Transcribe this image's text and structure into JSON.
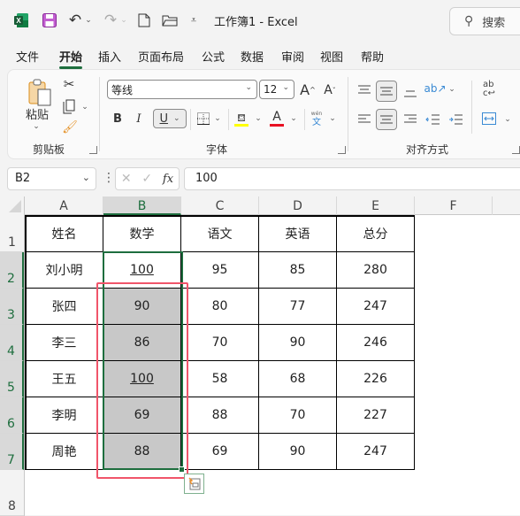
{
  "app": {
    "doc_title": "工作簿1 - Excel",
    "search_placeholder": "搜索",
    "icons": {
      "app_logo": "excel-logo-icon",
      "save": "save-icon",
      "undo": "undo-icon",
      "redo": "redo-icon",
      "new": "new-file-icon",
      "open": "open-folder-icon",
      "customize": "customize-toolbar-icon",
      "search": "search-icon"
    }
  },
  "menu_tabs": [
    {
      "label": "文件",
      "active": false
    },
    {
      "label": "开始",
      "active": true
    },
    {
      "label": "插入",
      "active": false
    },
    {
      "label": "页面布局",
      "active": false
    },
    {
      "label": "公式",
      "active": false
    },
    {
      "label": "数据",
      "active": false
    },
    {
      "label": "审阅",
      "active": false
    },
    {
      "label": "视图",
      "active": false
    },
    {
      "label": "帮助",
      "active": false
    }
  ],
  "ribbon": {
    "clipboard": {
      "label": "剪贴板",
      "paste_label": "粘贴"
    },
    "font": {
      "label": "字体",
      "font_name": "等线",
      "font_size": "12",
      "bold": "B",
      "italic": "I",
      "underline": "U",
      "font_color_swatch": "#e81123",
      "fill_color_swatch": "#ffff00",
      "phonetic_top": "wén",
      "phonetic_bottom": "文"
    },
    "alignment": {
      "label": "对齐方式"
    }
  },
  "formula_bar": {
    "name_box": "B2",
    "fx_label": "fx",
    "formula": "100"
  },
  "sheet": {
    "columns": [
      "A",
      "B",
      "C",
      "D",
      "E",
      "F"
    ],
    "selected_column": "B",
    "rows": [
      "1",
      "2",
      "3",
      "4",
      "5",
      "6",
      "7",
      "8"
    ],
    "selected_rows": [
      "2",
      "3",
      "4",
      "5",
      "6",
      "7"
    ],
    "header_row": [
      "姓名",
      "数学",
      "语文",
      "英语",
      "总分"
    ],
    "data": [
      [
        "刘小明",
        "100",
        "95",
        "85",
        "280"
      ],
      [
        "张四",
        "90",
        "80",
        "77",
        "247"
      ],
      [
        "李三",
        "86",
        "70",
        "90",
        "246"
      ],
      [
        "王五",
        "100",
        "58",
        "68",
        "226"
      ],
      [
        "李明",
        "69",
        "88",
        "70",
        "227"
      ],
      [
        "周艳",
        "88",
        "69",
        "90",
        "247"
      ]
    ],
    "underlined_cells": [
      "B2",
      "B5"
    ],
    "shaded_cells": [
      "B3",
      "B4",
      "B5",
      "B6",
      "B7"
    ],
    "selection_range": "B2:B7",
    "highlight_color": "#f0556a",
    "selection_color": "#1e6e3e"
  }
}
